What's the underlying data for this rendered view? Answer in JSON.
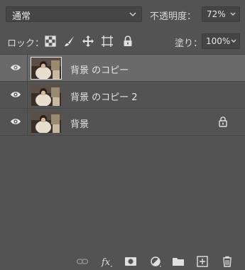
{
  "header": {
    "blend_mode": "通常",
    "opacity_label": "不透明度：",
    "opacity_value": "72%"
  },
  "lock_row": {
    "lock_label": "ロック：",
    "fill_label": "塗り：",
    "fill_value": "100%"
  },
  "layers": [
    {
      "name": "背景 のコピー",
      "selected": true,
      "locked": false
    },
    {
      "name": "背景 のコピー 2",
      "selected": false,
      "locked": false
    },
    {
      "name": "背景",
      "selected": false,
      "locked": true
    }
  ],
  "bottom_icons": [
    "link-layers-icon",
    "fx-icon",
    "add-mask-icon",
    "adjustment-layer-icon",
    "new-group-icon",
    "new-layer-icon",
    "trash-icon"
  ],
  "colors": {
    "panel_bg": "#535353",
    "selected_row": "#6a6a6a",
    "field_bg": "#454545"
  }
}
